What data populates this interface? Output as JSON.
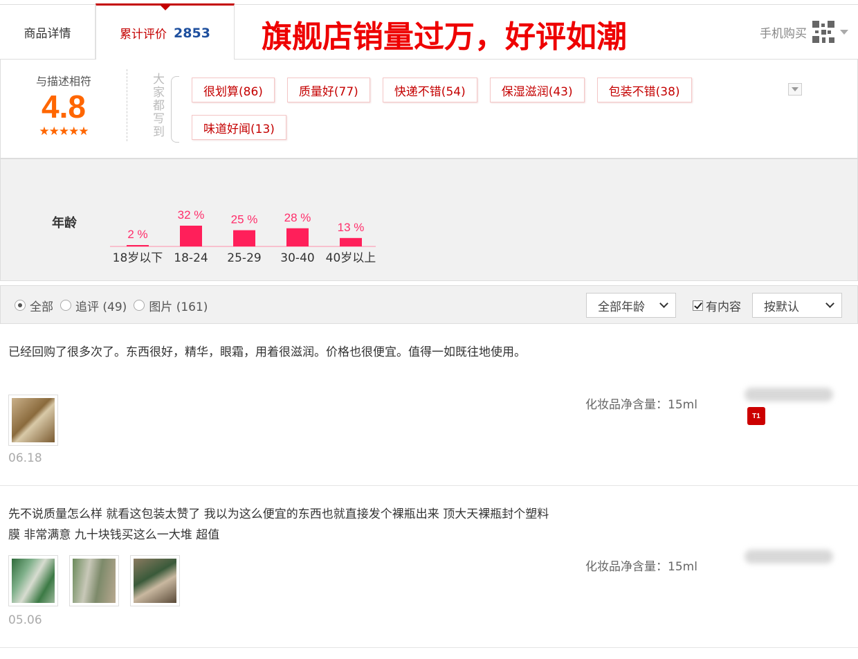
{
  "tabs": {
    "detail_label": "商品详情",
    "review_label": "累计评价",
    "review_count": "2853"
  },
  "promo_banner": "旗舰店销量过万，好评如潮",
  "mobile_buy": {
    "label": "手机购买"
  },
  "rating": {
    "label": "与描述相符",
    "score": "4.8",
    "stars": "★★★★★",
    "tags_heading": "大家都写到",
    "tags": [
      "很划算(86)",
      "质量好(77)",
      "快递不错(54)",
      "保湿滋润(43)",
      "包装不错(38)",
      "味道好闻(13)"
    ]
  },
  "age": {
    "label": "年龄"
  },
  "chart_data": {
    "type": "bar",
    "categories": [
      "18岁以下",
      "18-24",
      "25-29",
      "30-40",
      "40岁以上"
    ],
    "values": [
      2,
      32,
      25,
      28,
      13
    ],
    "value_labels": [
      "2 %",
      "32 %",
      "25 %",
      "28 %",
      "13 %"
    ],
    "ylim": [
      0,
      32
    ],
    "bar_color": "#ff1f5a",
    "label_color": "#ff2d6a",
    "grid": false
  },
  "filter": {
    "all": "全部",
    "followup": "追评 (49)",
    "photos": "图片 (161)",
    "age_select": "全部年龄",
    "has_content": "有内容",
    "sort_select": "按默认"
  },
  "reviews": [
    {
      "text": "已经回购了很多次了。东西很好，精华，眼霜，用着很滋润。价格也很便宜。值得一如既往地使用。",
      "date": "06.18",
      "spec": "化妆品净含量：15ml",
      "badge": "T1"
    },
    {
      "text": "先不说质量怎么样 就看这包装太赞了 我以为这么便宜的东西也就直接发个裸瓶出来 顶大天裸瓶封个塑料膜 非常满意 九十块钱买这么一大堆 超值",
      "date": "05.06",
      "spec": "化妆品净含量：15ml"
    }
  ],
  "colors": {
    "accent_red": "#c40000",
    "score_orange": "#ff6600",
    "count_blue": "#1e4f9e",
    "promo_red": "#ee0000"
  }
}
